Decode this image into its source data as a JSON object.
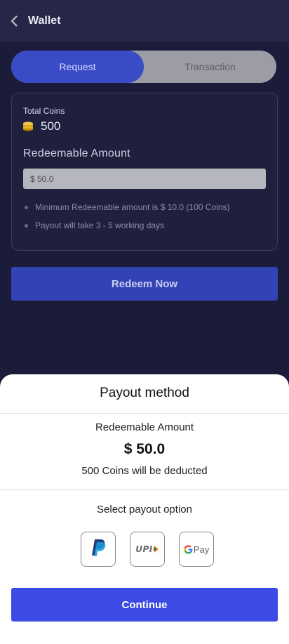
{
  "appbar": {
    "title": "Wallet",
    "back_icon": "chevron-left-icon"
  },
  "tabs": [
    {
      "label": "Request",
      "active": true
    },
    {
      "label": "Transaction",
      "active": false
    }
  ],
  "wallet_card": {
    "total_coins_label": "Total Coins",
    "coin_icon": "coin-stack-icon",
    "total_coins_value": "500",
    "redeemable_label": "Redeemable Amount",
    "amount_input_value": "$ 50.0",
    "notes": [
      "Minimum Redeemable amount is $ 10.0 (100 Coins)",
      "Payout will take 3 - 5 working days"
    ]
  },
  "redeem_button": "Redeem Now",
  "payout_sheet": {
    "title": "Payout method",
    "redeemable_label": "Redeemable Amount",
    "amount": "$ 50.0",
    "deduction_text": "500 Coins will be deducted",
    "select_label": "Select payout option",
    "options": [
      {
        "icon": "paypal-icon"
      },
      {
        "icon": "upi-icon",
        "text": "UPI"
      },
      {
        "icon": "google-pay-icon",
        "text": "Pay"
      }
    ],
    "continue_label": "Continue"
  },
  "colors": {
    "background": "#1b1b3a",
    "accent": "#3b4be3",
    "tab_active": "#3a4bc6",
    "coin_gold": "#d4a017"
  }
}
